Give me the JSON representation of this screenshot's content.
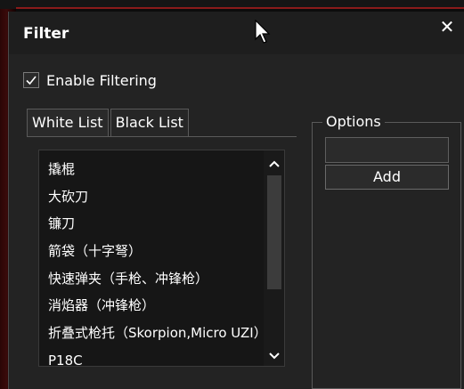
{
  "window": {
    "title": "Filter",
    "close_glyph": "✕"
  },
  "filter": {
    "enable_label": "Enable Filtering",
    "enabled": true
  },
  "tabs": [
    {
      "label": "White List"
    },
    {
      "label": "Black List"
    }
  ],
  "black_list": {
    "items": [
      "撬棍",
      "大砍刀",
      "镰刀",
      "箭袋（十字弩）",
      "快速弹夹（手枪、冲锋枪）",
      "消焰器（冲锋枪）",
      "折叠式枪托（Skorpion,Micro UZI）",
      "P18C"
    ]
  },
  "options": {
    "legend": "Options",
    "input_value": "",
    "add_label": "Add"
  },
  "icons": {
    "check": "check-icon",
    "close": "close-icon",
    "scroll_up": "chevron-up-icon",
    "scroll_down": "chevron-down-icon",
    "cursor": "mouse-cursor-icon"
  },
  "colors": {
    "window_bg": "#232323",
    "titlebar_bg": "#1e1e1e",
    "list_bg": "#161616",
    "accent_red": "#8a1a1a",
    "text": "#ffffff"
  }
}
